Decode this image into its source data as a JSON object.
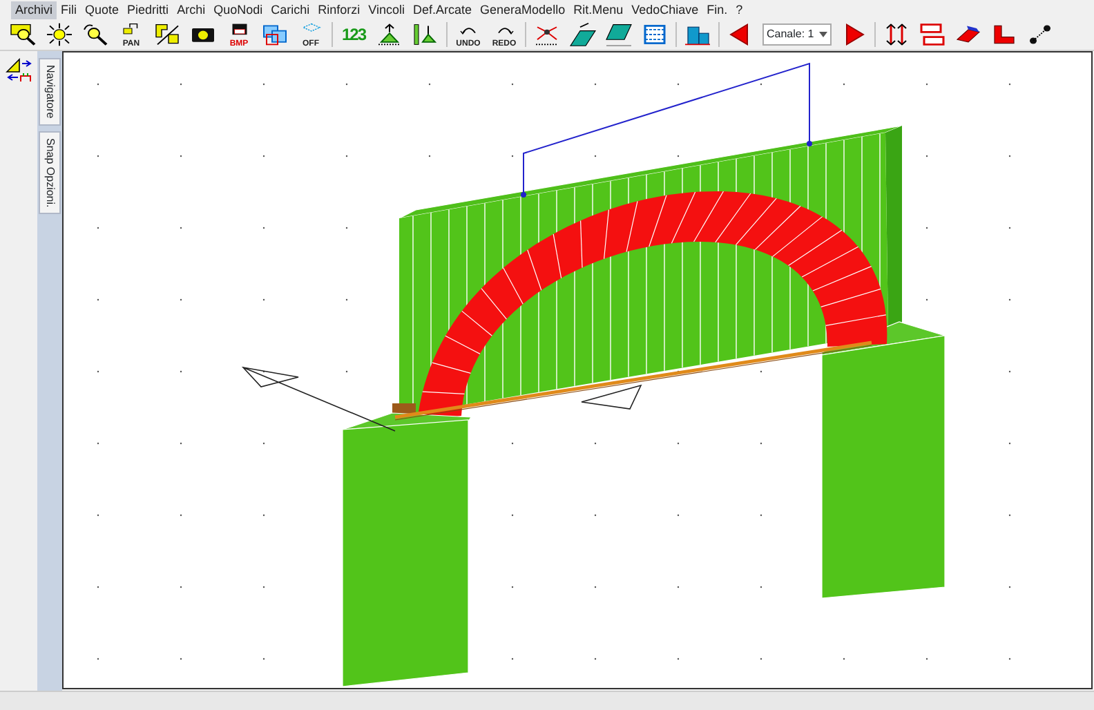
{
  "menu": [
    {
      "label": "Archivi",
      "selected": true
    },
    {
      "label": "Fili",
      "selected": false
    },
    {
      "label": "Quote",
      "selected": false
    },
    {
      "label": "Piedritti",
      "selected": false
    },
    {
      "label": "Archi",
      "selected": false
    },
    {
      "label": "QuoNodi",
      "selected": false
    },
    {
      "label": "Carichi",
      "selected": false
    },
    {
      "label": "Rinforzi",
      "selected": false
    },
    {
      "label": "Vincoli",
      "selected": false
    },
    {
      "label": "Def.Arcate",
      "selected": false
    },
    {
      "label": "GeneraModello",
      "selected": false
    },
    {
      "label": "Rit.Menu",
      "selected": false
    },
    {
      "label": "VedoChiave",
      "selected": false
    },
    {
      "label": "Fin.",
      "selected": false
    },
    {
      "label": "?",
      "selected": false
    }
  ],
  "toolbar": [
    {
      "kind": "button"
    },
    {
      "kind": "button"
    },
    {
      "kind": "button"
    },
    {
      "kind": "button",
      "label": "PAN"
    },
    {
      "kind": "button"
    },
    {
      "kind": "button"
    },
    {
      "kind": "button",
      "label": "BMP"
    },
    {
      "kind": "button"
    },
    {
      "kind": "button",
      "label": "OFF"
    },
    {
      "kind": "separator"
    },
    {
      "kind": "button",
      "label": "123"
    },
    {
      "kind": "button"
    },
    {
      "kind": "button"
    },
    {
      "kind": "separator"
    },
    {
      "kind": "button",
      "label": "UNDO"
    },
    {
      "kind": "button",
      "label": "REDO"
    },
    {
      "kind": "separator"
    },
    {
      "kind": "button"
    },
    {
      "kind": "button"
    },
    {
      "kind": "button"
    },
    {
      "kind": "button"
    },
    {
      "kind": "separator"
    },
    {
      "kind": "button"
    },
    {
      "kind": "separator"
    },
    {
      "kind": "button"
    },
    {
      "kind": "dropdown",
      "value": "Canale: 1"
    },
    {
      "kind": "button"
    },
    {
      "kind": "separator"
    },
    {
      "kind": "button"
    },
    {
      "kind": "button"
    },
    {
      "kind": "button"
    },
    {
      "kind": "button"
    },
    {
      "kind": "button"
    }
  ],
  "side_tabs": [
    {
      "label": "Navigatore"
    },
    {
      "label": "Snap Opzioni."
    }
  ]
}
